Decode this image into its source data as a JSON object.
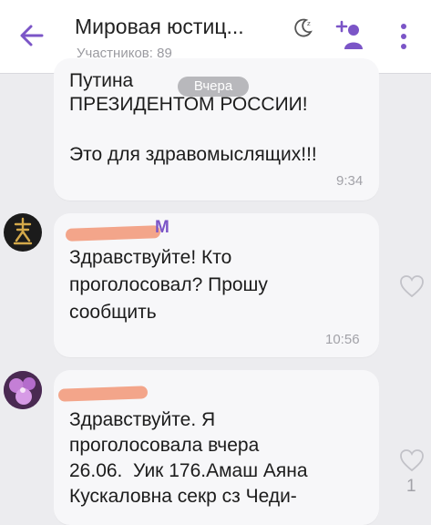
{
  "header": {
    "title": "Мировая юстиц...",
    "subtitle": "Участников: 89"
  },
  "date_separator": "Вчера",
  "messages": [
    {
      "lines": [
        "Путина",
        "ПРЕЗИДЕНТОМ РОССИИ!",
        "",
        "Это для здравомыслящих!!!"
      ],
      "time": "9:34"
    },
    {
      "sender_suffix": "М",
      "lines": [
        "Здравствуйте! Кто",
        "проголосовал? Прошу",
        "сообщить"
      ],
      "time": "10:56"
    },
    {
      "lines": [
        "Здравствуйте. Я",
        "проголосовала вчера",
        "26.06.  Уик 176.Амаш Аяна",
        "Кускаловна секр сз Чеди-"
      ],
      "like_count": "1"
    }
  ],
  "colors": {
    "accent": "#7b55c7",
    "redaction": "#f3a58a"
  },
  "icons": [
    "back-arrow-icon",
    "moon-icon",
    "add-member-icon",
    "more-vert-icon",
    "heart-icon"
  ]
}
